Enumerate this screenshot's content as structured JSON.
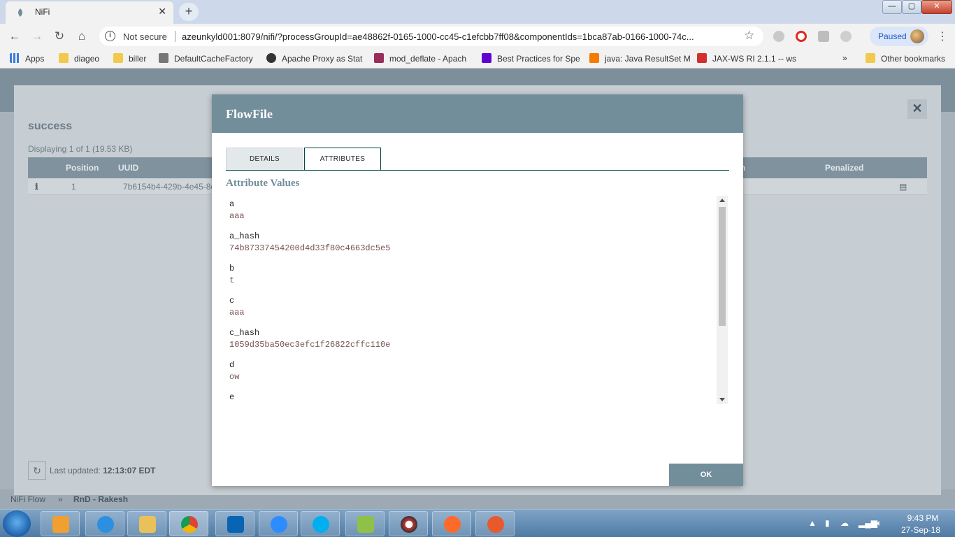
{
  "browser": {
    "tab_title": "NiFi",
    "new_tab_label": "+",
    "security_label": "Not secure",
    "url": "azeunkyld001:8079/nifi/?processGroupId=ae48862f-0165-1000-cc45-c1efcbb7ff08&componentIds=1bca87ab-0166-1000-74c...",
    "paused_label": "Paused",
    "bookmarks": [
      {
        "label": "Apps",
        "color": "#3a7be0"
      },
      {
        "label": "diageo",
        "color": "#f2c94c"
      },
      {
        "label": "biller",
        "color": "#f2c94c"
      },
      {
        "label": "DefaultCacheFactory",
        "color": "#555555"
      },
      {
        "label": "Apache Proxy as Stat",
        "color": "#333333"
      },
      {
        "label": "mod_deflate - Apach",
        "color": "#9b2d5a"
      },
      {
        "label": "Best Practices for Spe",
        "color": "#6001d2"
      },
      {
        "label": "java: Java ResultSet M",
        "color": "#f57c00"
      },
      {
        "label": "JAX-WS RI 2.1.1 -- ws",
        "color": "#d32f2f"
      }
    ],
    "bookmarks_overflow": "»",
    "other_bookmarks": "Other bookmarks"
  },
  "queue": {
    "title": "success",
    "count_text": "Displaying 1 of 1 (19.53 KB)",
    "columns": {
      "position": "Position",
      "uuid": "UUID",
      "penalized": "Penalized",
      "duration_fragment": "n"
    },
    "row": {
      "position": "1",
      "uuid": "7b6154b4-429b-4e45-8e"
    },
    "last_updated_label": "Last updated:",
    "last_updated_value": "12:13:07 EDT"
  },
  "nifi_breadcrumb": {
    "root": "NiFi Flow",
    "separator": "»",
    "current": "RnD - Rakesh"
  },
  "modal": {
    "title": "FlowFile",
    "tabs": {
      "details": "DETAILS",
      "attributes": "ATTRIBUTES"
    },
    "active_tab": "attributes",
    "section_title": "Attribute Values",
    "attributes": [
      {
        "name": "a",
        "value": "aaa"
      },
      {
        "name": "a_hash",
        "value": "74b87337454200d4d33f80c4663dc5e5"
      },
      {
        "name": "b",
        "value": "t"
      },
      {
        "name": "c",
        "value": "aaa"
      },
      {
        "name": "c_hash",
        "value": "1059d35ba50ec3efc1f26822cffc110e"
      },
      {
        "name": "d",
        "value": "ow"
      },
      {
        "name": "e",
        "value": ""
      }
    ],
    "ok_label": "OK"
  },
  "taskbar": {
    "time": "9:43 PM",
    "date": "27-Sep-18"
  },
  "colors": {
    "nifi_accent": "#728e9b",
    "attr_value": "#775351",
    "tab_border": "#004849"
  }
}
